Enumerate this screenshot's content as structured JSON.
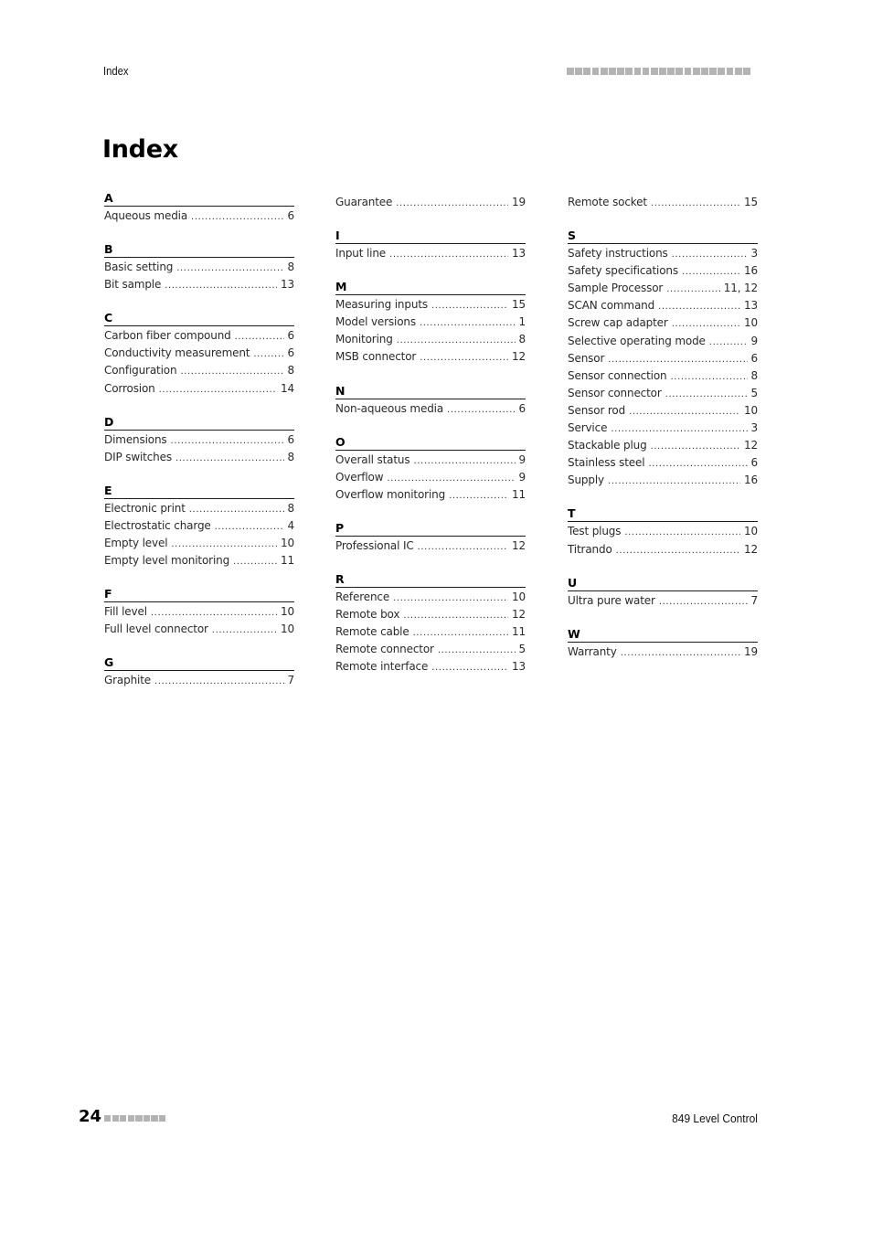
{
  "header": {
    "running_title": "Index",
    "decoration_squares": 22
  },
  "page_title": "Index",
  "columns": [
    {
      "groups": [
        {
          "letter": "A",
          "entries": [
            {
              "term": "Aqueous media",
              "page": "6"
            }
          ]
        },
        {
          "letter": "B",
          "entries": [
            {
              "term": "Basic setting",
              "page": "8"
            },
            {
              "term": "Bit sample",
              "page": "13"
            }
          ]
        },
        {
          "letter": "C",
          "entries": [
            {
              "term": "Carbon fiber compound",
              "page": "6"
            },
            {
              "term": "Conductivity measurement",
              "page": "6"
            },
            {
              "term": "Configuration",
              "page": "8"
            },
            {
              "term": "Corrosion",
              "page": "14"
            }
          ]
        },
        {
          "letter": "D",
          "entries": [
            {
              "term": "Dimensions",
              "page": "6"
            },
            {
              "term": "DIP switches",
              "page": "8"
            }
          ]
        },
        {
          "letter": "E",
          "entries": [
            {
              "term": "Electronic print",
              "page": "8"
            },
            {
              "term": "Electrostatic charge",
              "page": "4"
            },
            {
              "term": "Empty level",
              "page": "10"
            },
            {
              "term": "Empty level monitoring",
              "page": "11"
            }
          ]
        },
        {
          "letter": "F",
          "entries": [
            {
              "term": "Fill level",
              "page": "10"
            },
            {
              "term": "Full level connector",
              "page": "10"
            }
          ]
        },
        {
          "letter": "G",
          "entries": [
            {
              "term": "Graphite",
              "page": "7"
            }
          ]
        }
      ]
    },
    {
      "groups": [
        {
          "letter": "",
          "entries": [
            {
              "term": "Guarantee",
              "page": "19"
            }
          ]
        },
        {
          "letter": "I",
          "entries": [
            {
              "term": "Input line",
              "page": "13"
            }
          ]
        },
        {
          "letter": "M",
          "entries": [
            {
              "term": "Measuring inputs",
              "page": "15"
            },
            {
              "term": "Model versions",
              "page": "1"
            },
            {
              "term": "Monitoring",
              "page": "8"
            },
            {
              "term": "MSB connector",
              "page": "12"
            }
          ]
        },
        {
          "letter": "N",
          "entries": [
            {
              "term": "Non-aqueous media",
              "page": "6"
            }
          ]
        },
        {
          "letter": "O",
          "entries": [
            {
              "term": "Overall status",
              "page": "9"
            },
            {
              "term": "Overflow",
              "page": "9"
            },
            {
              "term": "Overflow monitoring",
              "page": "11"
            }
          ]
        },
        {
          "letter": "P",
          "entries": [
            {
              "term": "Professional IC",
              "page": "12"
            }
          ]
        },
        {
          "letter": "R",
          "entries": [
            {
              "term": "Reference",
              "page": "10"
            },
            {
              "term": "Remote box",
              "page": "12"
            },
            {
              "term": "Remote cable",
              "page": "11"
            },
            {
              "term": "Remote connector",
              "page": "5"
            },
            {
              "term": "Remote interface",
              "page": "13"
            }
          ]
        }
      ]
    },
    {
      "groups": [
        {
          "letter": "",
          "entries": [
            {
              "term": "Remote socket",
              "page": "15"
            }
          ]
        },
        {
          "letter": "S",
          "entries": [
            {
              "term": "Safety instructions",
              "page": "3"
            },
            {
              "term": "Safety specifications",
              "page": "16"
            },
            {
              "term": "Sample Processor",
              "page": "11, 12"
            },
            {
              "term": "SCAN command",
              "page": "13"
            },
            {
              "term": "Screw cap adapter",
              "page": "10"
            },
            {
              "term": "Selective operating mode",
              "page": "9"
            },
            {
              "term": "Sensor",
              "page": "6"
            },
            {
              "term": "Sensor connection",
              "page": "8"
            },
            {
              "term": "Sensor connector",
              "page": "5"
            },
            {
              "term": "Sensor rod",
              "page": "10"
            },
            {
              "term": "Service",
              "page": "3"
            },
            {
              "term": "Stackable plug",
              "page": "12"
            },
            {
              "term": "Stainless steel",
              "page": "6"
            },
            {
              "term": "Supply",
              "page": "16"
            }
          ]
        },
        {
          "letter": "T",
          "entries": [
            {
              "term": "Test plugs",
              "page": "10"
            },
            {
              "term": "Titrando",
              "page": "12"
            }
          ]
        },
        {
          "letter": "U",
          "entries": [
            {
              "term": "Ultra pure water",
              "page": "7"
            }
          ]
        },
        {
          "letter": "W",
          "entries": [
            {
              "term": "Warranty",
              "page": "19"
            }
          ]
        }
      ]
    }
  ],
  "footer": {
    "page_number": "24",
    "decoration_squares": 8,
    "document_title": "849 Level Control"
  },
  "colors": {
    "text": "#1a1a1a",
    "decoration_gray": "#b3b3b3"
  }
}
